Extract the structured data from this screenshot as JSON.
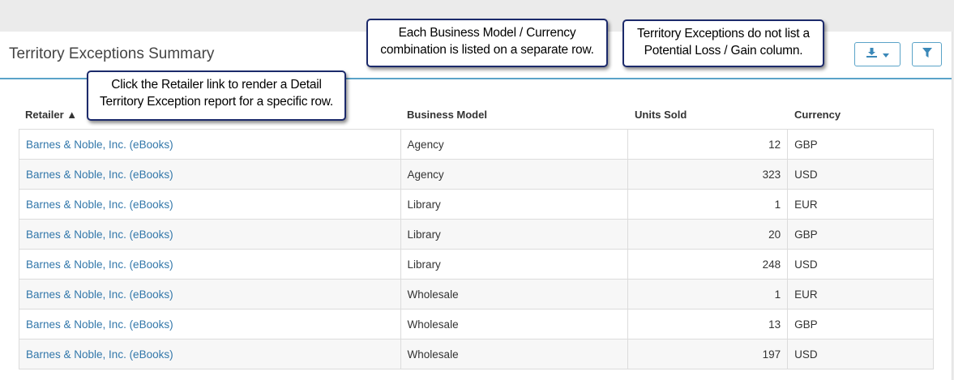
{
  "report": {
    "title": "Territory Exceptions Summary"
  },
  "toolbar": {
    "download_icon": "download-icon",
    "filter_icon": "filter-icon"
  },
  "callouts": {
    "business_model": [
      "Each Business Model / Currency",
      "combination is listed  on a separate row."
    ],
    "territory": [
      "Territory Exceptions do not list a",
      "Potential Loss / Gain column."
    ],
    "retailer": [
      "Click the Retailer link to render a Detail",
      "Territory Exception report for a specific row."
    ]
  },
  "table": {
    "columns": [
      "Retailer ▲",
      "Business Model",
      "Units Sold",
      "Currency"
    ],
    "rows": [
      {
        "retailer": "Barnes & Noble, Inc. (eBooks)",
        "business_model": "Agency",
        "units_sold": "12",
        "currency": "GBP"
      },
      {
        "retailer": "Barnes & Noble, Inc. (eBooks)",
        "business_model": "Agency",
        "units_sold": "323",
        "currency": "USD"
      },
      {
        "retailer": "Barnes & Noble, Inc. (eBooks)",
        "business_model": "Library",
        "units_sold": "1",
        "currency": "EUR"
      },
      {
        "retailer": "Barnes & Noble, Inc. (eBooks)",
        "business_model": "Library",
        "units_sold": "20",
        "currency": "GBP"
      },
      {
        "retailer": "Barnes & Noble, Inc. (eBooks)",
        "business_model": "Library",
        "units_sold": "248",
        "currency": "USD"
      },
      {
        "retailer": "Barnes & Noble, Inc. (eBooks)",
        "business_model": "Wholesale",
        "units_sold": "1",
        "currency": "EUR"
      },
      {
        "retailer": "Barnes & Noble, Inc. (eBooks)",
        "business_model": "Wholesale",
        "units_sold": "13",
        "currency": "GBP"
      },
      {
        "retailer": "Barnes & Noble, Inc. (eBooks)",
        "business_model": "Wholesale",
        "units_sold": "197",
        "currency": "USD"
      }
    ]
  }
}
